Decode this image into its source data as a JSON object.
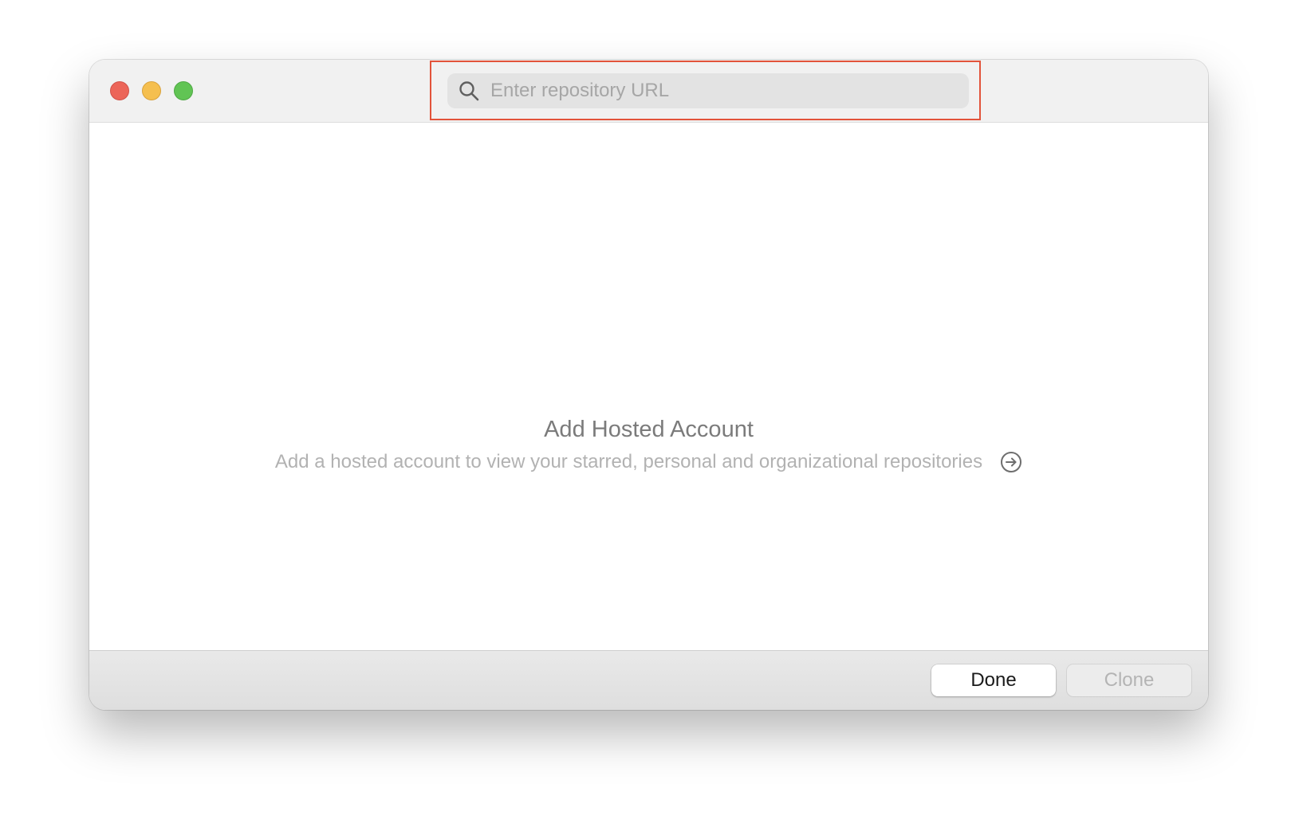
{
  "search": {
    "placeholder": "Enter repository URL",
    "value": "",
    "icon": "search-icon"
  },
  "window_controls": [
    "close",
    "minimize",
    "zoom"
  ],
  "empty_state": {
    "title": "Add Hosted Account",
    "subtitle": "Add a hosted account to view your starred, personal and organizational repositories",
    "action_icon": "arrow-right-circle-icon"
  },
  "footer": {
    "done_label": "Done",
    "clone_label": "Clone"
  },
  "colors": {
    "highlight": "#e2533a",
    "close": "#ec6559",
    "minimize": "#f5bf4f",
    "zoom": "#61c454"
  }
}
